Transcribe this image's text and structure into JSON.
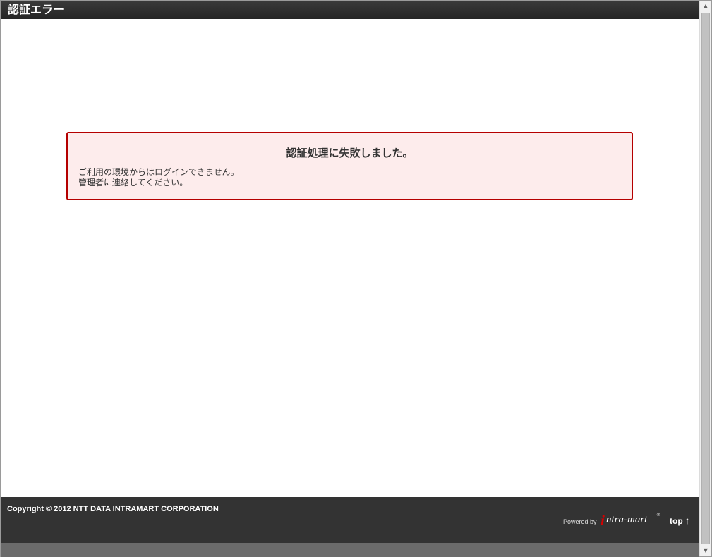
{
  "window": {
    "title": "認証エラー"
  },
  "error": {
    "title": "認証処理に失敗しました。",
    "message_line1": "ご利用の環境からはログインできません。",
    "message_line2": "管理者に連絡してください。"
  },
  "footer": {
    "copyright": "Copyright © 2012 NTT DATA INTRAMART CORPORATION",
    "powered_by": "Powered by",
    "logo_initial": "i",
    "logo_text": "ntra-mart",
    "logo_reg": "®",
    "top_label": "top",
    "top_arrow": "↑"
  },
  "scrollbar": {
    "up_arrow": "▲",
    "down_arrow": "▼"
  },
  "colors": {
    "title_bar": "#2b2b2b",
    "error_border": "#b50000",
    "error_background": "#fdecec",
    "footer_background": "#333333",
    "logo_accent": "#d40000"
  }
}
